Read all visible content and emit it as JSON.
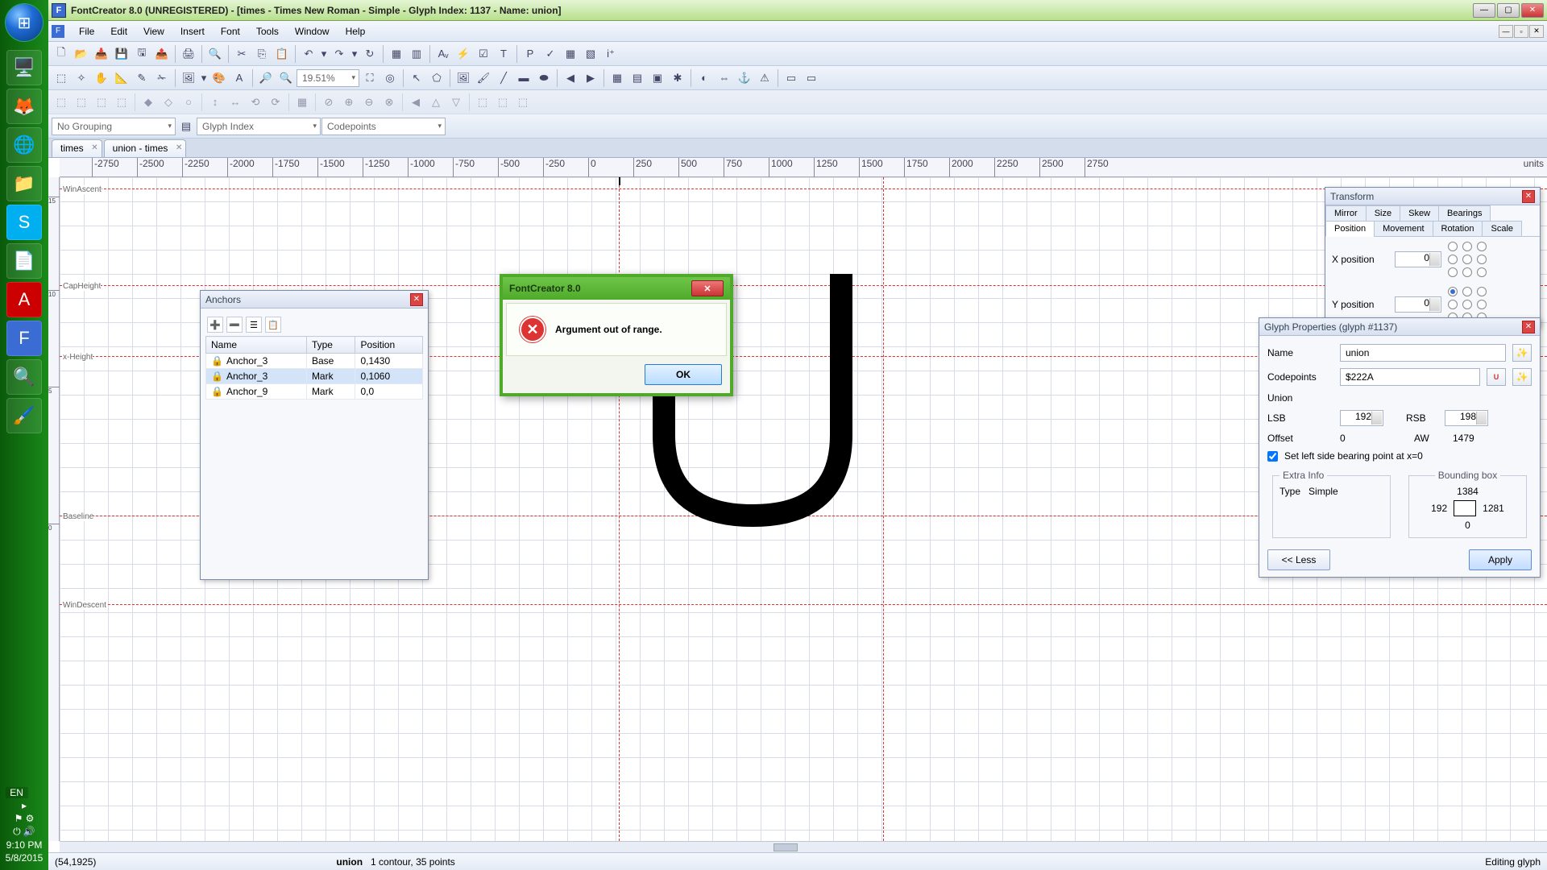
{
  "title": "FontCreator 8.0 (UNREGISTERED) - [times - Times New Roman - Simple - Glyph Index: 1137 - Name: union]",
  "menu": [
    "File",
    "Edit",
    "View",
    "Insert",
    "Font",
    "Tools",
    "Window",
    "Help"
  ],
  "taskbar": {
    "lang": "EN",
    "time": "9:10 PM",
    "date": "5/8/2015"
  },
  "zoom": "19.51%",
  "grouping": "No Grouping",
  "sortby": "Glyph Index",
  "codepoints_filter": "Codepoints",
  "tabs": [
    {
      "label": "times"
    },
    {
      "label": "union - times"
    }
  ],
  "ruler_ticks": [
    "-2750",
    "-2500",
    "-2250",
    "-2000",
    "-1750",
    "-1500",
    "-1250",
    "-1000",
    "-750",
    "-500",
    "-250",
    "0",
    "250",
    "500",
    "750",
    "1000",
    "1250",
    "1500",
    "1750",
    "2000",
    "2250",
    "2500",
    "2750"
  ],
  "ruler_units": "units",
  "guides": {
    "ascent": "WinAscent",
    "cap": "CapHeight",
    "xh": "x-Height",
    "base": "Baseline",
    "desc": "WinDescent"
  },
  "v_ticks": [
    "15",
    "10",
    "5",
    "0"
  ],
  "anchors": {
    "title": "Anchors",
    "cols": [
      "Name",
      "Type",
      "Position"
    ],
    "rows": [
      {
        "name": "Anchor_3",
        "type": "Base",
        "pos": "0,1430"
      },
      {
        "name": "Anchor_3",
        "type": "Mark",
        "pos": "0,1060",
        "sel": true
      },
      {
        "name": "Anchor_9",
        "type": "Mark",
        "pos": "0,0"
      }
    ]
  },
  "transform": {
    "title": "Transform",
    "tabs_top": [
      "Mirror",
      "Size",
      "Skew",
      "Bearings"
    ],
    "tabs_bot": [
      "Position",
      "Movement",
      "Rotation",
      "Scale"
    ],
    "active": "Position",
    "xpos_label": "X position",
    "xpos": "0",
    "ypos_label": "Y position",
    "ypos": "0"
  },
  "glyphprop": {
    "title": "Glyph Properties (glyph #1137)",
    "name_label": "Name",
    "name": "union",
    "code_label": "Codepoints",
    "code": "$222A",
    "unicode_name": "Union",
    "lsb_label": "LSB",
    "lsb": "192",
    "rsb_label": "RSB",
    "rsb": "198",
    "offset_label": "Offset",
    "offset": "0",
    "aw_label": "AW",
    "aw": "1479",
    "setlsb": "Set left side bearing point at x=0",
    "extra_title": "Extra Info",
    "type_label": "Type",
    "type": "Simple",
    "bb_title": "Bounding box",
    "bb_top": "1384",
    "bb_left": "192",
    "bb_right": "1281",
    "bb_bot": "0",
    "less": "<< Less",
    "apply": "Apply"
  },
  "dialog": {
    "title": "FontCreator 8.0",
    "msg": "Argument out of range.",
    "ok": "OK"
  },
  "status": {
    "coords": "(54,1925)",
    "glyph": "union",
    "contour": "1 contour, 35 points",
    "mode": "Editing glyph"
  }
}
